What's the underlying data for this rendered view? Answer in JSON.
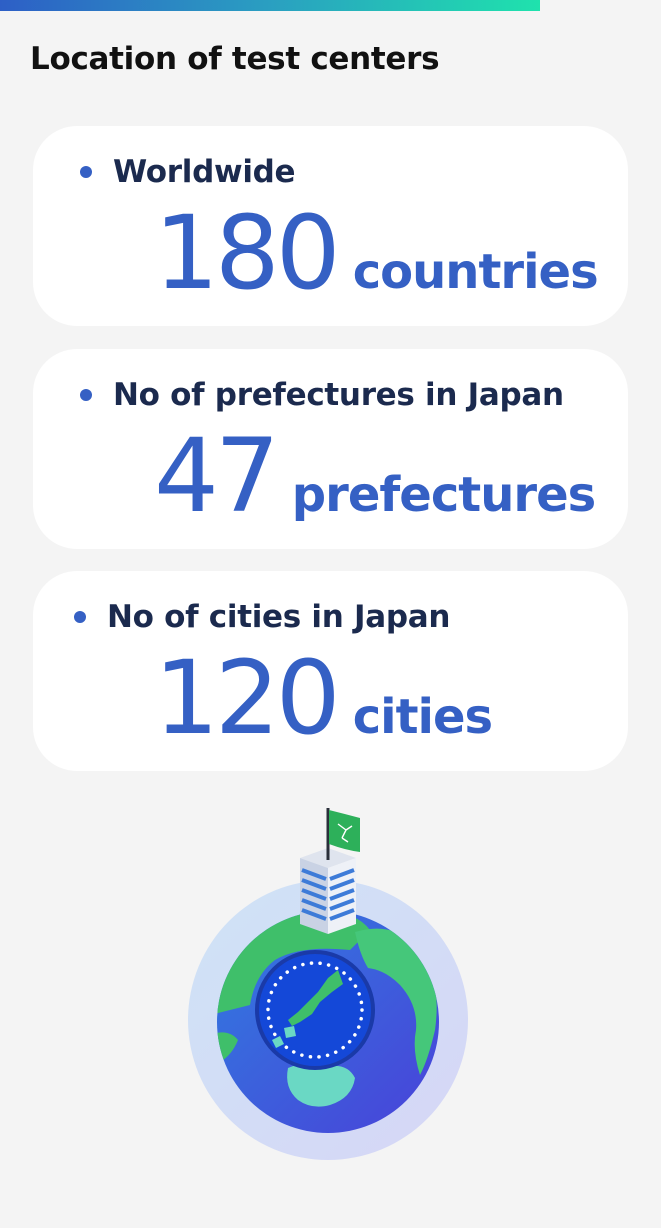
{
  "header": {
    "title": "Location of test centers"
  },
  "stats": [
    {
      "label": "Worldwide",
      "value": "180",
      "unit": "countries"
    },
    {
      "label": "No of prefectures in Japan",
      "value": "47",
      "unit": "prefectures"
    },
    {
      "label": "No of cities in Japan",
      "value": "120",
      "unit": "cities"
    }
  ],
  "colors": {
    "accent": "#3560c4",
    "label": "#1b2a4e",
    "background": "#f4f4f4",
    "card": "#ffffff",
    "bar_gradient": [
      "#2d5fc6",
      "#2a9fc1",
      "#1fe2ad"
    ]
  },
  "illustration": {
    "icon": "globe-with-building-icon"
  }
}
